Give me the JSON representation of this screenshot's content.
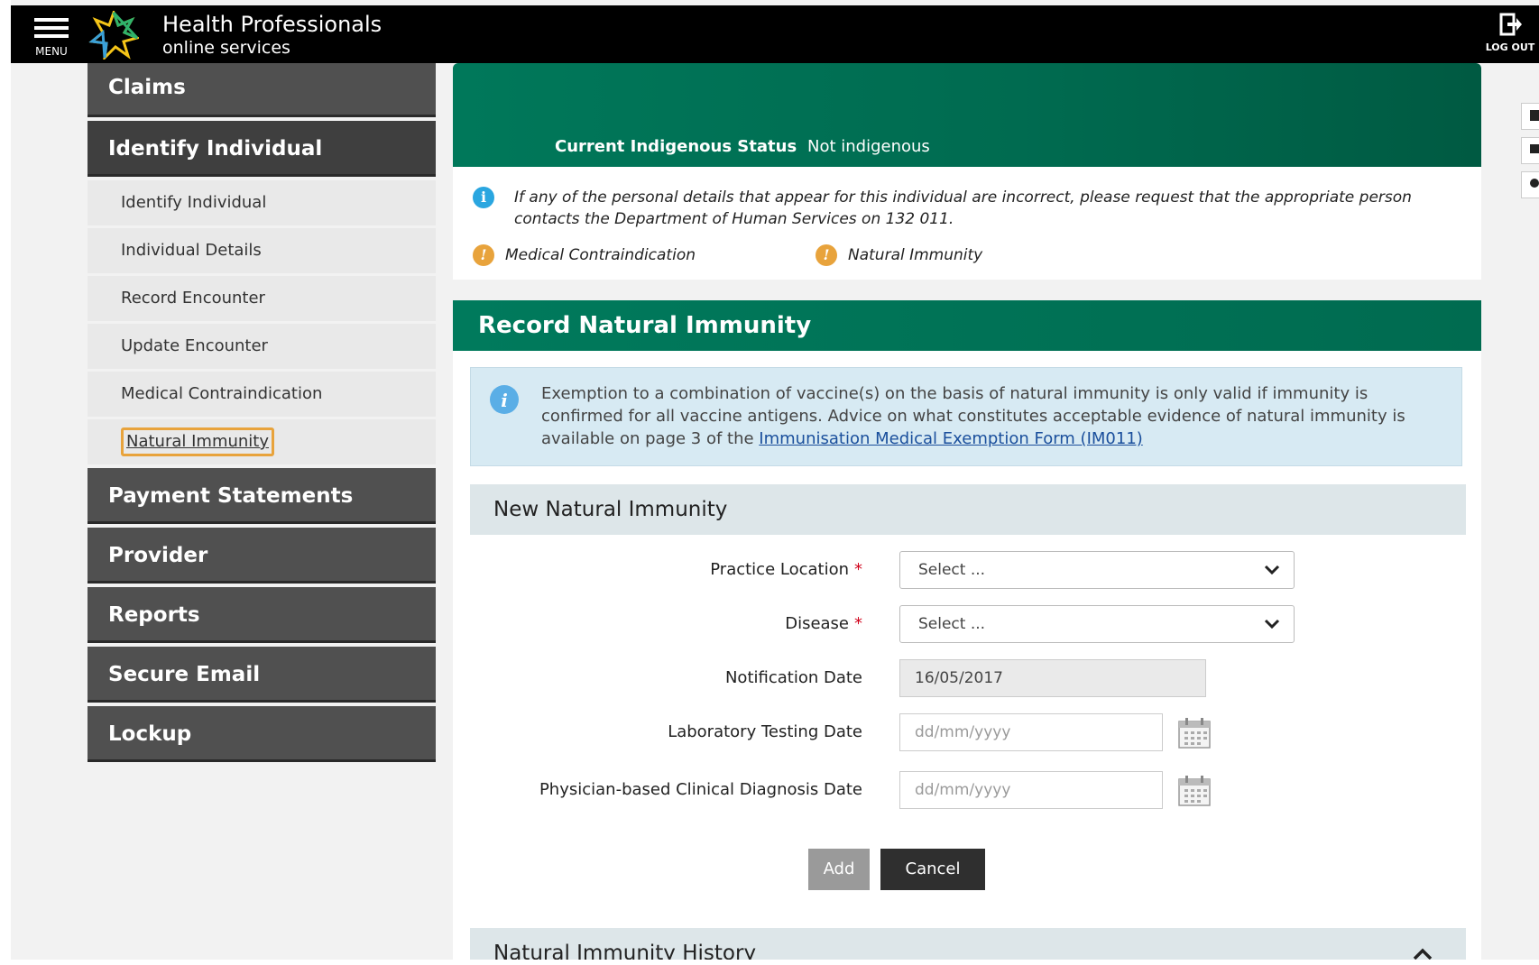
{
  "header": {
    "menu_label": "MENU",
    "brand_line1": "Health Professionals",
    "brand_line2": "online services",
    "logout_label": "LOG OUT"
  },
  "sidebar": {
    "items": [
      {
        "label": "Claims"
      },
      {
        "label": "Identify Individual",
        "active": true
      },
      {
        "label": "Payment Statements"
      },
      {
        "label": "Provider"
      },
      {
        "label": "Reports"
      },
      {
        "label": "Secure Email"
      },
      {
        "label": "Lockup"
      }
    ],
    "subitems": [
      {
        "label": "Identify Individual"
      },
      {
        "label": "Individual Details"
      },
      {
        "label": "Record Encounter"
      },
      {
        "label": "Update Encounter"
      },
      {
        "label": "Medical Contraindication"
      },
      {
        "label": "Natural Immunity",
        "current": true
      }
    ]
  },
  "status": {
    "label": "Current Indigenous Status",
    "value": "Not indigenous"
  },
  "notice": {
    "text": "If any of the personal details that appear for this individual are incorrect, please request that the appropriate person contacts the Department of Human Services on 132 011.",
    "alerts": [
      "Medical Contraindication",
      "Natural Immunity"
    ]
  },
  "section": {
    "title": "Record Natural Immunity",
    "exemption_text": "Exemption to a combination of vaccine(s) on the basis of natural immunity is only valid if immunity is confirmed for all vaccine antigens. Advice on what constitutes acceptable evidence of natural immunity is available on page 3 of the ",
    "exemption_link": "Immunisation Medical Exemption Form (IM011)"
  },
  "form": {
    "title": "New Natural Immunity",
    "practice_location": {
      "label": "Practice Location",
      "value": "Select ..."
    },
    "disease": {
      "label": "Disease",
      "value": "Select ..."
    },
    "notification_date": {
      "label": "Notification Date",
      "value": "16/05/2017"
    },
    "lab_testing_date": {
      "label": "Laboratory Testing Date",
      "placeholder": "dd/mm/yyyy"
    },
    "physician_date": {
      "label": "Physician-based Clinical Diagnosis Date",
      "placeholder": "dd/mm/yyyy"
    },
    "required_mark": "*",
    "add_label": "Add",
    "cancel_label": "Cancel"
  },
  "history": {
    "title": "Natural Immunity History"
  },
  "colors": {
    "header_bg": "#000000",
    "brand_green": "#006b50",
    "sidebar_bg": "#505050",
    "focus_outline": "#e8a33c",
    "info_blue": "#2aa6e0",
    "alert_orange": "#e8a33c",
    "required_red": "#d0021b"
  },
  "icons": [
    "menu-icon",
    "logo-icon",
    "logout-icon",
    "info-icon",
    "warning-icon",
    "chevron-down-icon",
    "calendar-icon",
    "chevron-up-icon"
  ]
}
